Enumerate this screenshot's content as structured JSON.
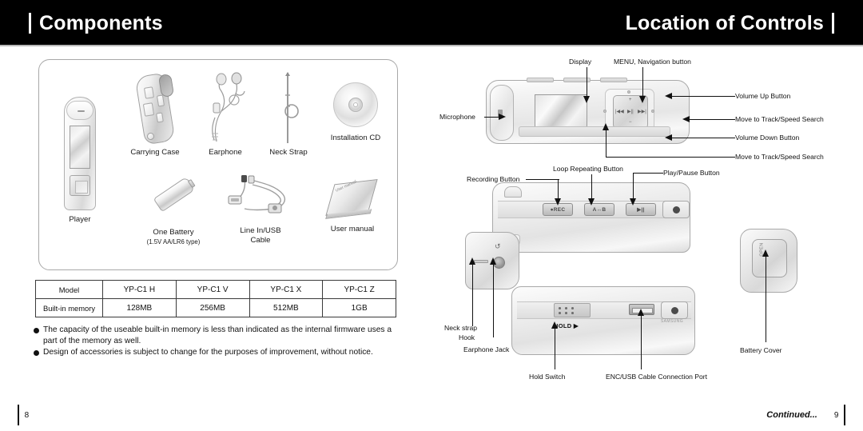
{
  "header": {
    "left_title": "Components",
    "right_title": "Location of Controls"
  },
  "components": {
    "items": [
      {
        "name": "player",
        "label": "Player",
        "sublabel": ""
      },
      {
        "name": "carrying-case",
        "label": "Carrying Case",
        "sublabel": ""
      },
      {
        "name": "earphone",
        "label": "Earphone",
        "sublabel": ""
      },
      {
        "name": "neck-strap",
        "label": "Neck Strap",
        "sublabel": ""
      },
      {
        "name": "installation-cd",
        "label": "Installation CD",
        "sublabel": ""
      },
      {
        "name": "one-battery",
        "label": "One Battery",
        "sublabel": "(1.5V AA/LR6 type)"
      },
      {
        "name": "line-in-usb-cable",
        "label": "Line In/USB",
        "sublabel": "Cable"
      },
      {
        "name": "user-manual",
        "label": "User manual",
        "sublabel": ""
      }
    ],
    "manual_cover_text": "User manual"
  },
  "spec_table": {
    "rows": [
      {
        "header": "Model",
        "cells": [
          "YP-C1 H",
          "YP-C1 V",
          "YP-C1 X",
          "YP-C1 Z"
        ]
      },
      {
        "header": "Built-in memory",
        "cells": [
          "128MB",
          "256MB",
          "512MB",
          "1GB"
        ]
      }
    ]
  },
  "notes": [
    "The capacity of the useable built-in memory is less than indicated as the internal firmware uses a part of the memory as well.",
    "Design of accessories is subject to change for the purposes of improvement, without notice."
  ],
  "controls": {
    "front_view": {
      "labels": [
        {
          "name": "display",
          "text": "Display"
        },
        {
          "name": "menu-navigation-button",
          "text": "MENU, Navigation button"
        },
        {
          "name": "microphone",
          "text": "Microphone"
        },
        {
          "name": "volume-up-button",
          "text": "Volume Up Button"
        },
        {
          "name": "move-to-track-speed-search-upper",
          "text": "Move to Track/Speed Search"
        },
        {
          "name": "volume-down-button",
          "text": "Volume Down Button"
        },
        {
          "name": "move-to-track-speed-search-lower",
          "text": "Move to Track/Speed Search"
        }
      ],
      "navpad_marks": {
        "left": "|◀◀",
        "center": "▶||",
        "right": "▶▶|",
        "up": "+",
        "down": "−"
      }
    },
    "side_view": {
      "labels": [
        {
          "name": "recording-button",
          "text": "Recording Button"
        },
        {
          "name": "loop-repeating-button",
          "text": "Loop Repeating Button"
        },
        {
          "name": "play-pause-button",
          "text": "Play/Pause Button"
        }
      ],
      "keys": [
        {
          "name": "rec-key",
          "text": "●REC"
        },
        {
          "name": "ab-key",
          "text": "A↔B"
        },
        {
          "name": "play-pause-key",
          "text": "▶||"
        }
      ]
    },
    "left_side_view": {
      "labels": [
        {
          "name": "neck-strap-hook",
          "line1": "Neck strap",
          "line2": "Hook"
        },
        {
          "name": "earphone-jack",
          "line1": "Earphone Jack",
          "line2": ""
        }
      ]
    },
    "bottom_view": {
      "labels": [
        {
          "name": "hold-switch",
          "text": "Hold Switch"
        },
        {
          "name": "enc-usb-cable-connection-port",
          "text": "ENC/USB Cable Connection Port"
        }
      ],
      "hold_text": "HOLD ▶",
      "brand_text": "SAMSUNG"
    },
    "battery_cover": {
      "label": {
        "name": "battery-cover",
        "text": "Battery Cover"
      },
      "open_text": "OPEN"
    }
  },
  "footer": {
    "left_page_number": "8",
    "right_page_number": "9",
    "continued_text": "Continued..."
  }
}
